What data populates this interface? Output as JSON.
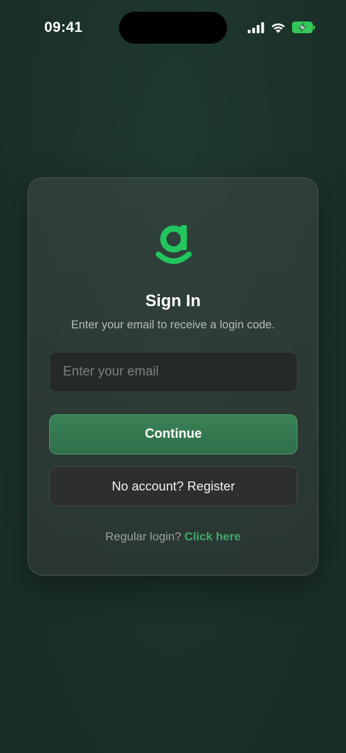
{
  "status_bar": {
    "time": "09:41",
    "icons": [
      "cellular-signal-icon",
      "wifi-icon",
      "battery-charging-icon"
    ],
    "battery_color": "#34c759"
  },
  "card": {
    "logo": "brand-g-logo",
    "title": "Sign In",
    "subtitle": "Enter your email to receive a login code.",
    "email_input": {
      "value": "",
      "placeholder": "Enter your email"
    },
    "continue_label": "Continue",
    "register_label": "No account? Register",
    "footer": {
      "prefix": "Regular login?",
      "link_label": "Click here"
    }
  },
  "colors": {
    "background": "#1b3129",
    "brand_green": "#22c55e",
    "primary_button": "#347a50",
    "link": "#3fa86a"
  }
}
